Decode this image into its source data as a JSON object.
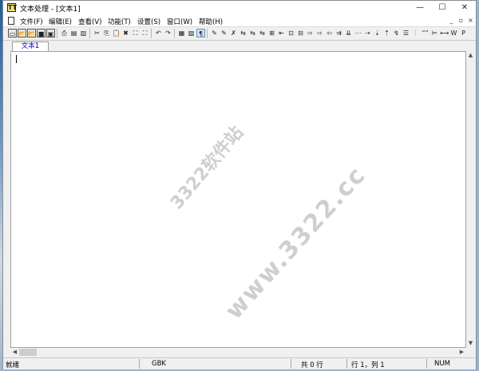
{
  "window": {
    "title": "文本处理 - [文本1]",
    "app_icon_glyph": "TT"
  },
  "window_controls": {
    "minimize": "—",
    "maximize": "☐",
    "close": "✕"
  },
  "menu": {
    "items": [
      "文件(F)",
      "编辑(E)",
      "查看(V)",
      "功能(T)",
      "设置(S)",
      "窗口(W)",
      "帮助(H)"
    ],
    "mdi_controls": [
      "_",
      "▫",
      "×"
    ]
  },
  "toolbar": {
    "icons": [
      "new-file-icon",
      "open-folder-icon",
      "open-recent-icon",
      "save-icon",
      "save-all-icon",
      "print-icon",
      "print-preview-icon",
      "page-setup-icon",
      "cut-icon",
      "copy-icon",
      "paste-icon",
      "delete-icon",
      "find-icon",
      "find-replace-icon",
      "undo-icon",
      "redo-icon",
      "table-icon",
      "window-icon",
      "pilcrow-icon",
      "tool-a-icon",
      "tool-b-icon",
      "tool-c-icon",
      "tool-d-icon",
      "tool-e-icon",
      "tool-f-icon",
      "tool-g-icon",
      "tool-h-icon",
      "tool-i-icon",
      "tool-j-icon",
      "tool-k-icon",
      "tool-l-icon",
      "tool-m-icon",
      "tool-n-icon",
      "tool-o-icon",
      "tool-p-icon",
      "tool-q-icon",
      "tool-r-icon",
      "tool-s-icon",
      "tool-t-icon",
      "tool-u-icon",
      "tool-v-icon",
      "quote-icon",
      "align-icon",
      "width-icon",
      "w-icon",
      "p-icon"
    ],
    "glyphs": [
      "▭",
      "📂",
      "📂",
      "■",
      "▣",
      "⎙",
      "▤",
      "▥",
      "✂",
      "⎘",
      "📋",
      "✖",
      "⛶",
      "⛶",
      "↶",
      "↷",
      "▦",
      "▧",
      "¶",
      "✎",
      "✎",
      "✗",
      "⇆",
      "⇆",
      "⇆",
      "⊞",
      "⇤",
      "⊡",
      "⊟",
      "⇨",
      "⇨",
      "⇦",
      "⇉",
      "⇊",
      "⋯",
      "⇢",
      "⇣",
      "⇡",
      "↯",
      "☰",
      "⫶",
      "“”",
      "⊨",
      "⟷",
      "W",
      "P"
    ],
    "pilcrow_active": true
  },
  "tabs": [
    "文本1"
  ],
  "editor": {
    "content": "",
    "watermark_top": "3322软件站",
    "watermark_main": "www.3322.cc"
  },
  "status": {
    "ready": "就绪",
    "encoding": "GBK",
    "line_count": "共 0 行",
    "cursor": "行 1，列 1",
    "numlock": "NUM"
  }
}
